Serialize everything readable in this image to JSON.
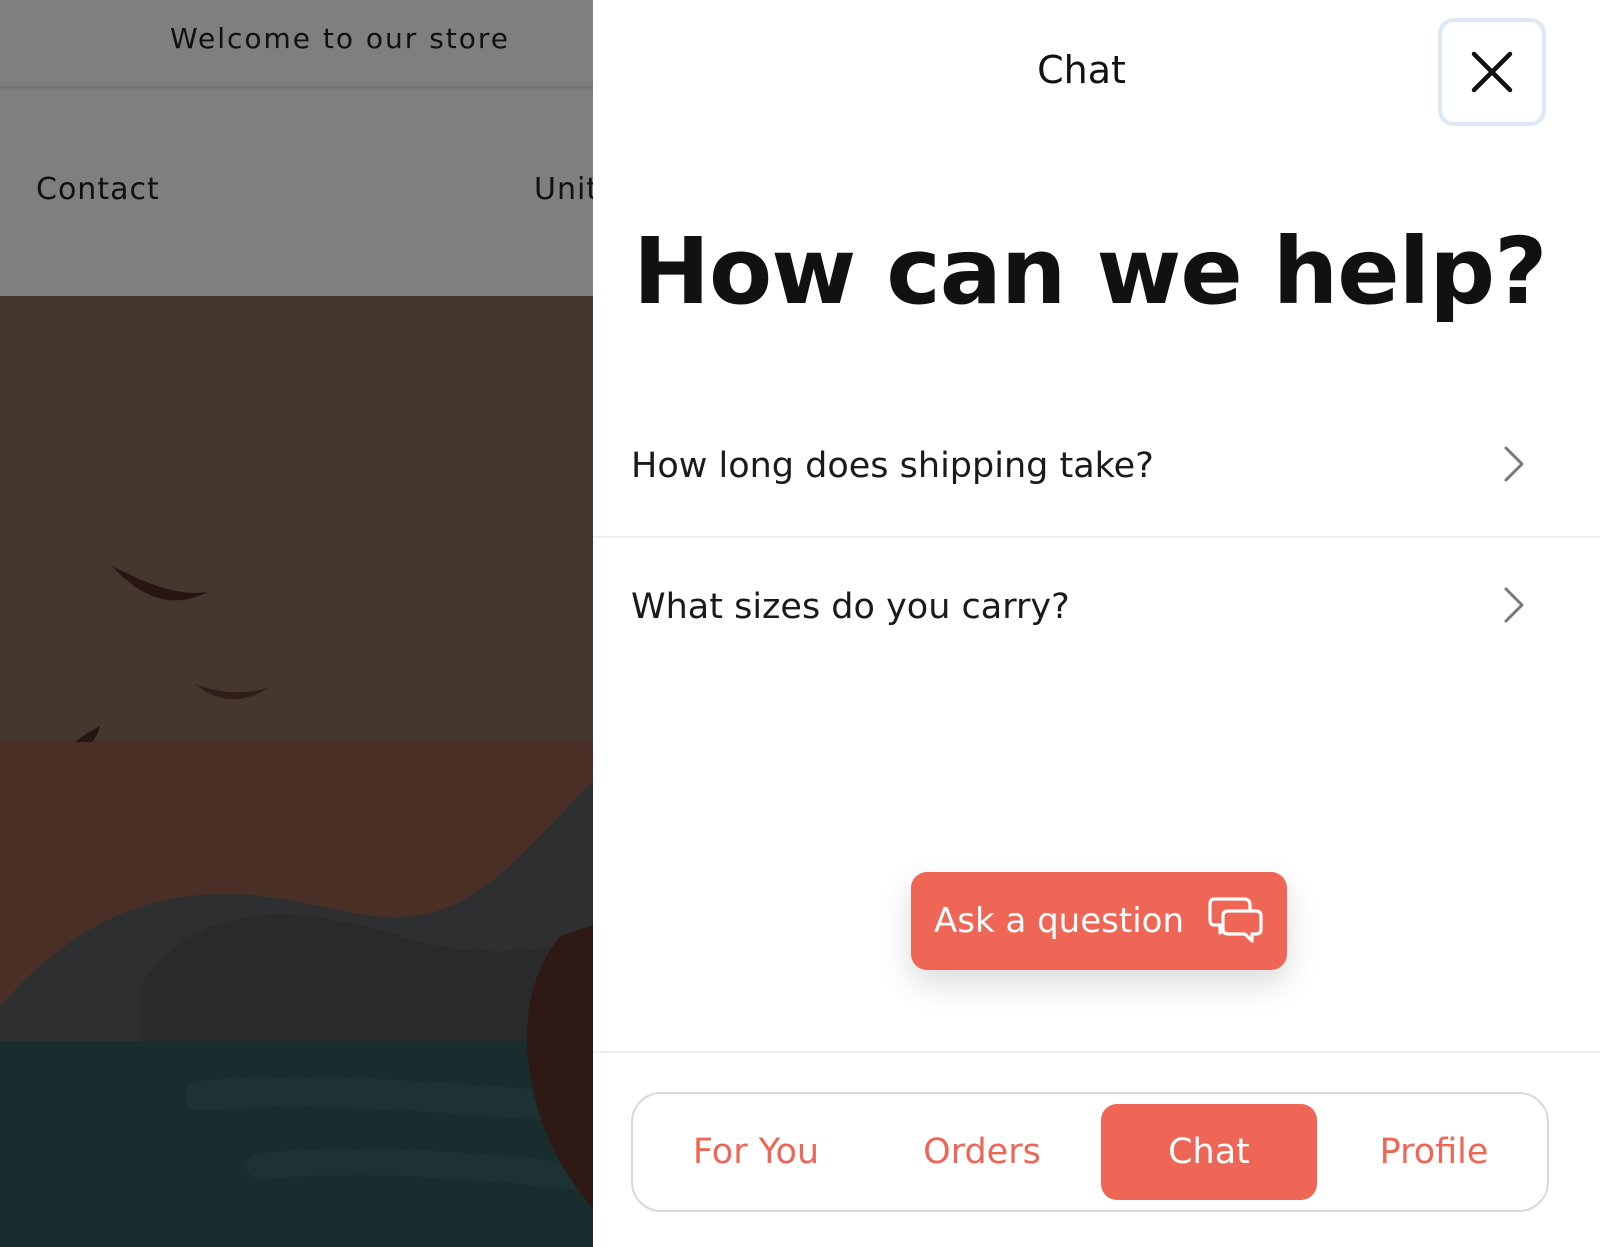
{
  "store": {
    "announcement": "Welcome to our store",
    "nav": {
      "contact": "Contact",
      "region_partial": "Unit"
    }
  },
  "chat": {
    "title": "Chat",
    "close_icon": "close-icon",
    "headline": "How can we help?",
    "faq": [
      {
        "question": "How long does shipping take?",
        "icon": "chevron-right-icon"
      },
      {
        "question": "What sizes do you carry?",
        "icon": "chevron-right-icon"
      }
    ],
    "ask_button": {
      "label": "Ask a question",
      "icon": "chat-bubbles-icon"
    },
    "tabs": [
      {
        "label": "For You",
        "active": false
      },
      {
        "label": "Orders",
        "active": false
      },
      {
        "label": "Chat",
        "active": true
      },
      {
        "label": "Profile",
        "active": false
      }
    ]
  },
  "colors": {
    "accent": "#ef6656",
    "overlay": "rgba(0,0,0,0.5)",
    "close_border": "#dce9f5"
  }
}
